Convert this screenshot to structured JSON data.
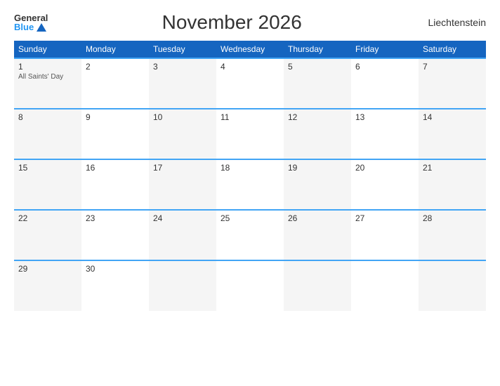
{
  "header": {
    "logo_general": "General",
    "logo_blue": "Blue",
    "title": "November 2026",
    "country": "Liechtenstein"
  },
  "weekdays": [
    "Sunday",
    "Monday",
    "Tuesday",
    "Wednesday",
    "Thursday",
    "Friday",
    "Saturday"
  ],
  "weeks": [
    [
      {
        "day": "1",
        "event": "All Saints' Day",
        "shaded": true
      },
      {
        "day": "2",
        "event": "",
        "shaded": false
      },
      {
        "day": "3",
        "event": "",
        "shaded": true
      },
      {
        "day": "4",
        "event": "",
        "shaded": false
      },
      {
        "day": "5",
        "event": "",
        "shaded": true
      },
      {
        "day": "6",
        "event": "",
        "shaded": false
      },
      {
        "day": "7",
        "event": "",
        "shaded": true
      }
    ],
    [
      {
        "day": "8",
        "event": "",
        "shaded": true
      },
      {
        "day": "9",
        "event": "",
        "shaded": false
      },
      {
        "day": "10",
        "event": "",
        "shaded": true
      },
      {
        "day": "11",
        "event": "",
        "shaded": false
      },
      {
        "day": "12",
        "event": "",
        "shaded": true
      },
      {
        "day": "13",
        "event": "",
        "shaded": false
      },
      {
        "day": "14",
        "event": "",
        "shaded": true
      }
    ],
    [
      {
        "day": "15",
        "event": "",
        "shaded": true
      },
      {
        "day": "16",
        "event": "",
        "shaded": false
      },
      {
        "day": "17",
        "event": "",
        "shaded": true
      },
      {
        "day": "18",
        "event": "",
        "shaded": false
      },
      {
        "day": "19",
        "event": "",
        "shaded": true
      },
      {
        "day": "20",
        "event": "",
        "shaded": false
      },
      {
        "day": "21",
        "event": "",
        "shaded": true
      }
    ],
    [
      {
        "day": "22",
        "event": "",
        "shaded": true
      },
      {
        "day": "23",
        "event": "",
        "shaded": false
      },
      {
        "day": "24",
        "event": "",
        "shaded": true
      },
      {
        "day": "25",
        "event": "",
        "shaded": false
      },
      {
        "day": "26",
        "event": "",
        "shaded": true
      },
      {
        "day": "27",
        "event": "",
        "shaded": false
      },
      {
        "day": "28",
        "event": "",
        "shaded": true
      }
    ],
    [
      {
        "day": "29",
        "event": "",
        "shaded": true
      },
      {
        "day": "30",
        "event": "",
        "shaded": false
      },
      {
        "day": "",
        "event": "",
        "shaded": true
      },
      {
        "day": "",
        "event": "",
        "shaded": false
      },
      {
        "day": "",
        "event": "",
        "shaded": true
      },
      {
        "day": "",
        "event": "",
        "shaded": false
      },
      {
        "day": "",
        "event": "",
        "shaded": true
      }
    ]
  ]
}
